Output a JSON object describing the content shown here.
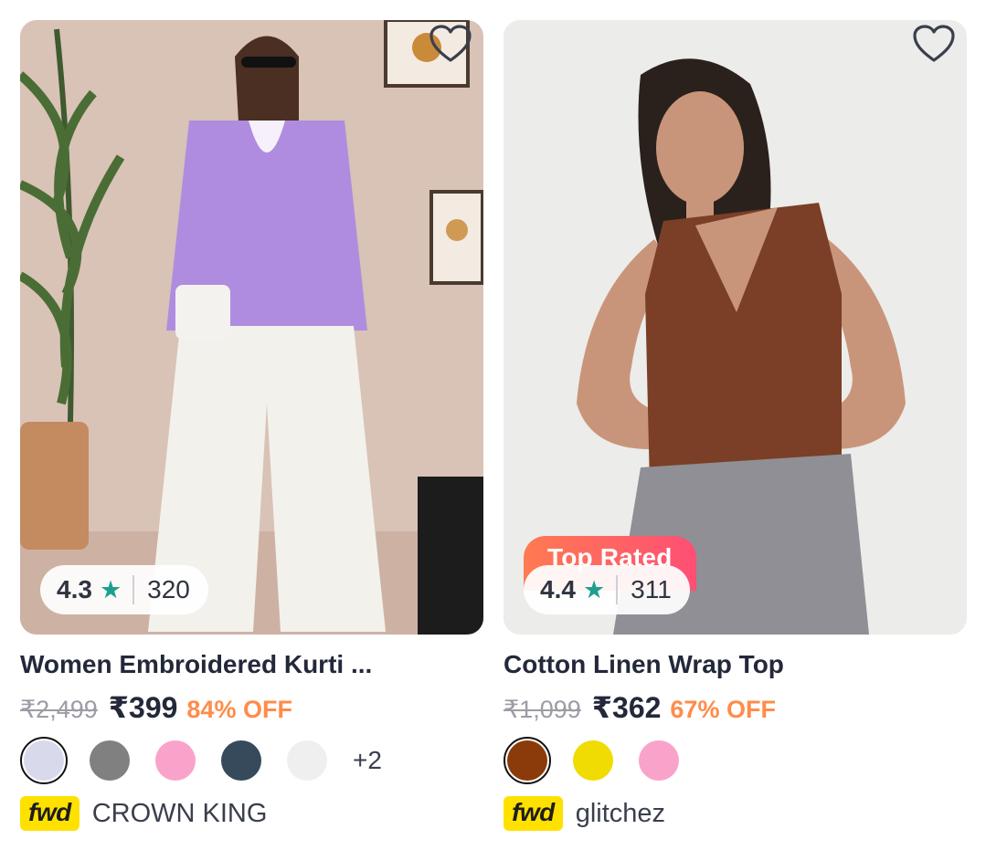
{
  "products": [
    {
      "title": "Women Embroidered Kurti ...",
      "rating": "4.3",
      "rating_count": "320",
      "mrp": "₹2,499",
      "price": "₹399",
      "discount": "84% OFF",
      "swatch_colors": [
        "#d9d9ec",
        "#808080",
        "#f9a3cb",
        "#364a5c",
        "#efefef"
      ],
      "more_colors": "+2",
      "fulfillment_badge": "fwd",
      "brand": "CROWN KING",
      "image_icon": "product-photo-icon"
    },
    {
      "badge": "Top Rated",
      "title": "Cotton Linen Wrap Top",
      "rating": "4.4",
      "rating_count": "311",
      "mrp": "₹1,099",
      "price": "₹362",
      "discount": "67% OFF",
      "swatch_colors": [
        "#8b3a0a",
        "#f0dc00",
        "#f9a3cb"
      ],
      "fulfillment_badge": "fwd",
      "brand": "glitchez",
      "image_icon": "product-photo-icon"
    }
  ],
  "colors": {
    "accent_discount": "#ff8c4a",
    "rating_star": "#1e9f8e",
    "fwd_badge": "#ffe100"
  }
}
